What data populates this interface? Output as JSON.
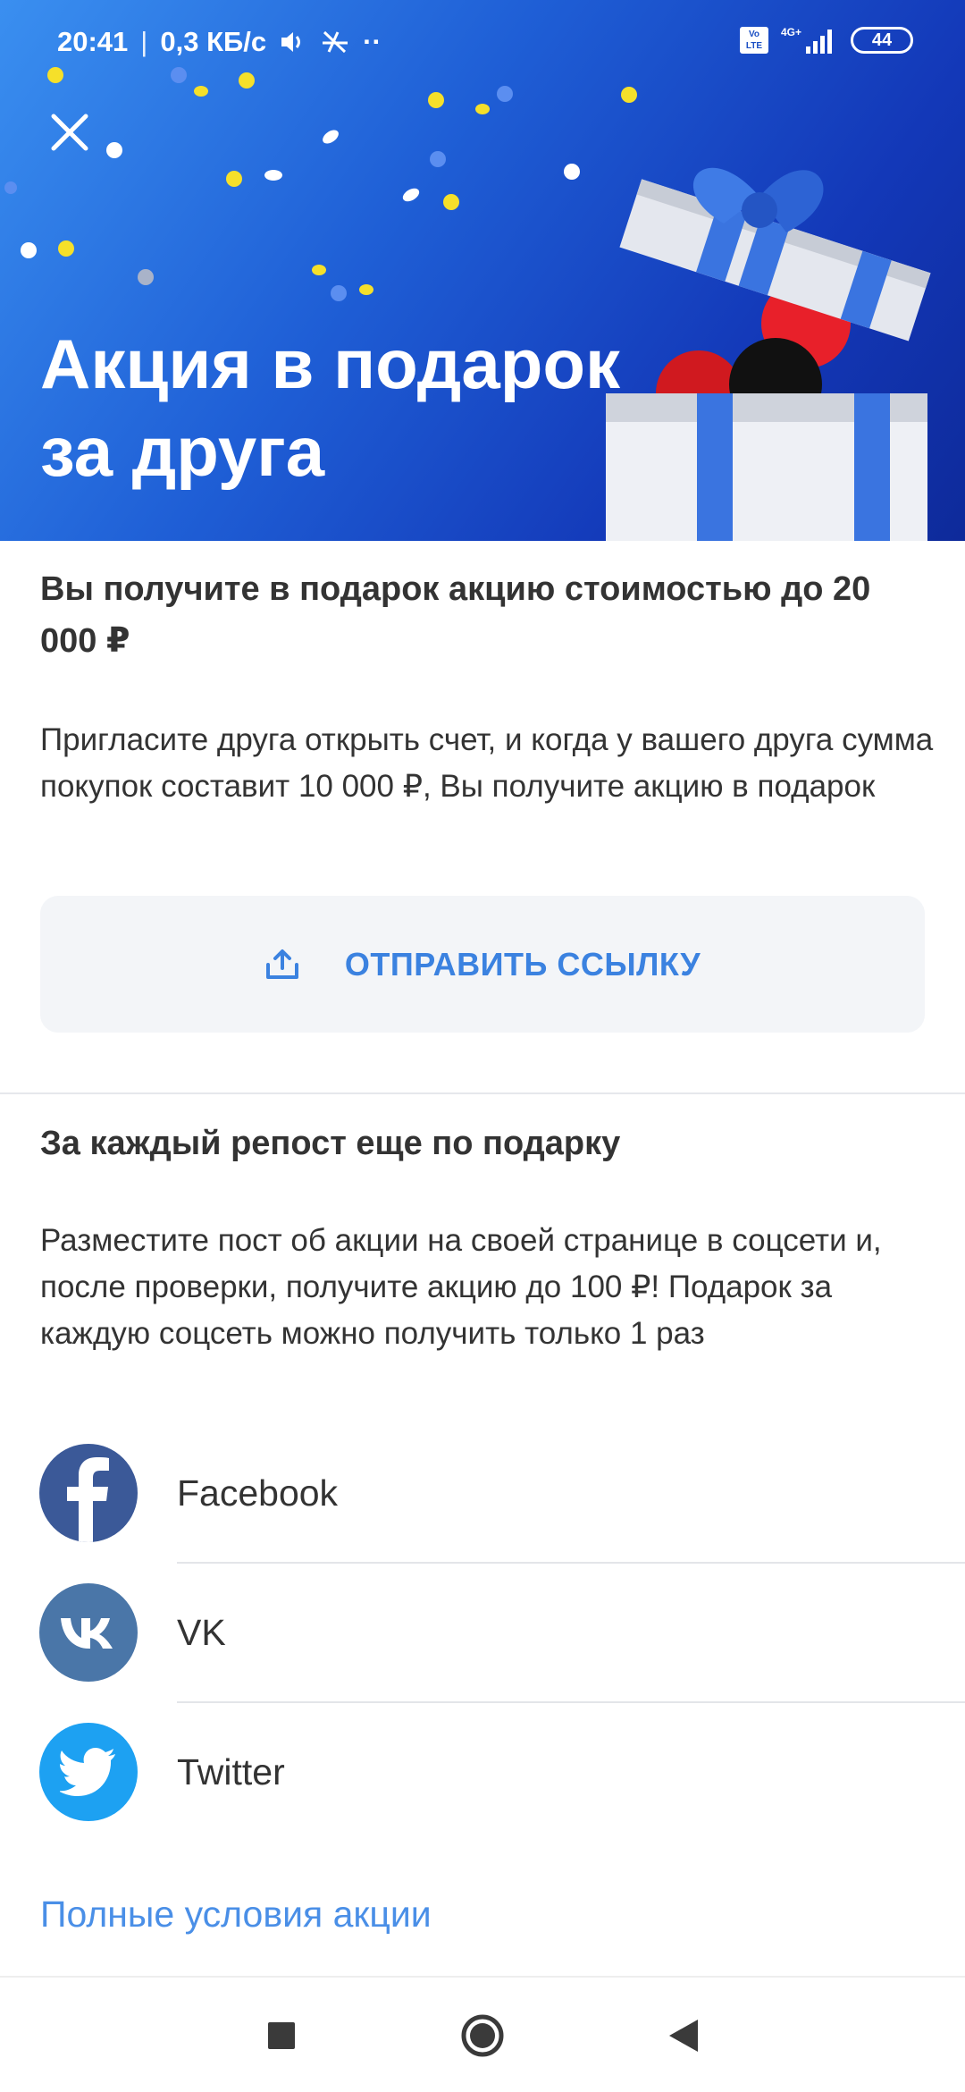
{
  "status_bar": {
    "time": "20:41",
    "speed": "0,3 КБ/с",
    "volte": "Vo LTE",
    "network": "4G+",
    "battery": "44"
  },
  "hero": {
    "title": "Акция в подарок за друга",
    "colors": {
      "gradient_start": "#3a8ff0",
      "gradient_end": "#0e2a9a"
    }
  },
  "invite": {
    "heading": "Вы получите в подарок акцию стоимостью до 20 000 ₽",
    "body": "Пригласите друга открыть счет, и когда у вашего друга сумма покупок составит 10 000 ₽, Вы получите акцию в подарок",
    "button_label": "ОТПРАВИТЬ ССЫЛКУ",
    "button_icon": "share-icon"
  },
  "repost": {
    "heading": "За каждый репост еще по подарку",
    "body": "Разместите пост об акции на своей странице в соцсети и, после проверки, получите акцию до 100 ₽! Подарок за каждую соцсеть можно получить только 1 раз",
    "socials": [
      {
        "label": "Facebook",
        "icon": "facebook-icon",
        "color": "#3b5998"
      },
      {
        "label": "VK",
        "icon": "vk-icon",
        "color": "#4a76a8"
      },
      {
        "label": "Twitter",
        "icon": "twitter-icon",
        "color": "#1da1f2"
      }
    ]
  },
  "terms_link": "Полные условия акции",
  "nav": {
    "recents": "square-icon",
    "home": "circle-icon",
    "back": "triangle-back-icon"
  }
}
